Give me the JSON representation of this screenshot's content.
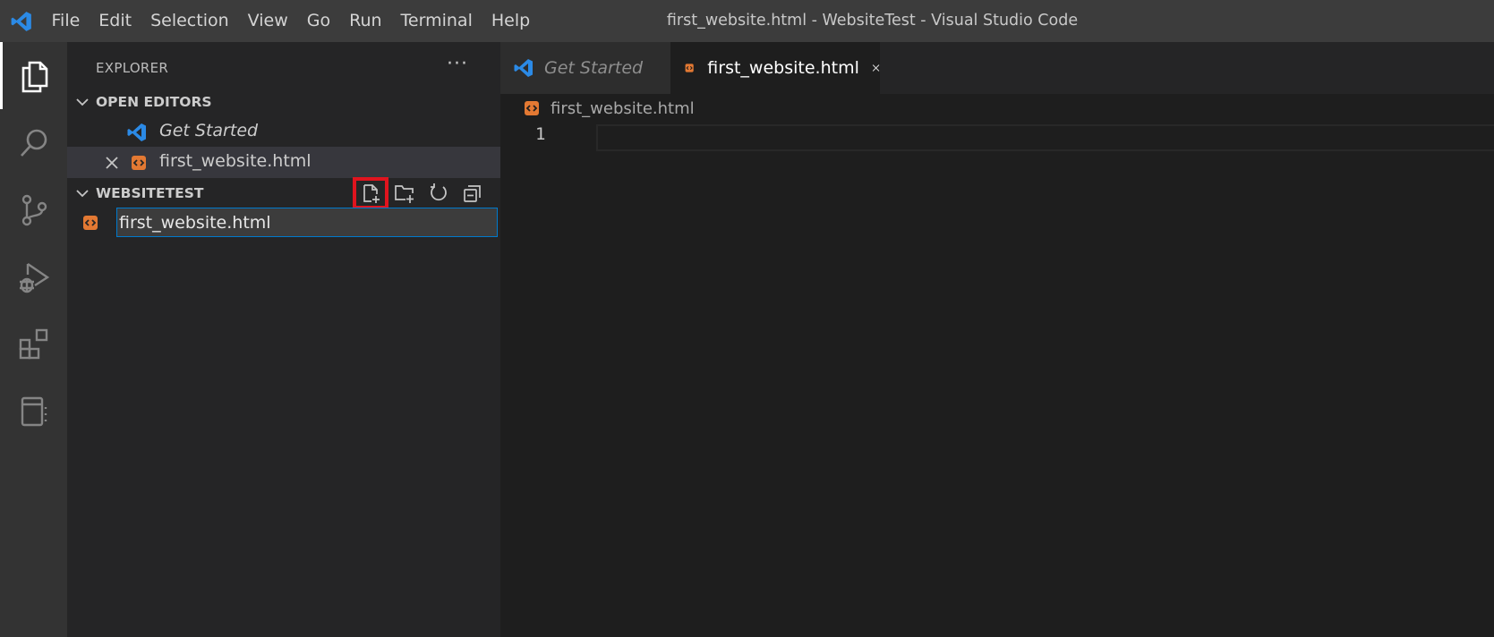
{
  "titlebar": {
    "menu": [
      "File",
      "Edit",
      "Selection",
      "View",
      "Go",
      "Run",
      "Terminal",
      "Help"
    ],
    "window_title": "first_website.html - WebsiteTest - Visual Studio Code"
  },
  "activitybar": {
    "icons": [
      "explorer-icon",
      "search-icon",
      "source-control-icon",
      "run-debug-icon",
      "extensions-icon",
      "notebook-icon"
    ]
  },
  "sidebar": {
    "title": "EXPLORER",
    "more": "···",
    "open_editors": {
      "label": "OPEN EDITORS",
      "items": [
        {
          "label": "Get Started"
        },
        {
          "label": "first_website.html"
        }
      ]
    },
    "workspace": {
      "label": "WEBSITETEST",
      "new_file_value": "first_website.html"
    }
  },
  "editor": {
    "tabs": [
      {
        "label": "Get Started",
        "active": false
      },
      {
        "label": "first_website.html",
        "active": true
      }
    ],
    "breadcrumb": "first_website.html",
    "line_number": "1"
  },
  "colors": {
    "accent": "#007acc",
    "html_file": "#e37933",
    "highlight": "#e0141e",
    "vscode_blue": "#2b8ae6"
  }
}
